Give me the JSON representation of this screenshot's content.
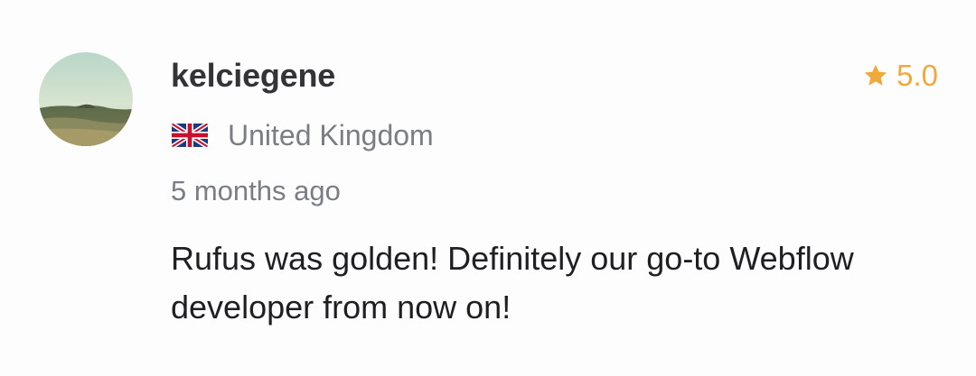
{
  "review": {
    "username": "kelciegene",
    "rating": "5.0",
    "country": "United Kingdom",
    "time_ago": "5 months ago",
    "text": "Rufus was golden! Definitely our go-to Webflow developer from now on!"
  },
  "colors": {
    "star": "#f2a93b",
    "username": "#333338",
    "muted": "#7b7d85",
    "body": "#1f1f23"
  },
  "icons": {
    "avatar": "landscape-photo",
    "rating": "star-icon",
    "flag": "uk-flag-icon"
  }
}
